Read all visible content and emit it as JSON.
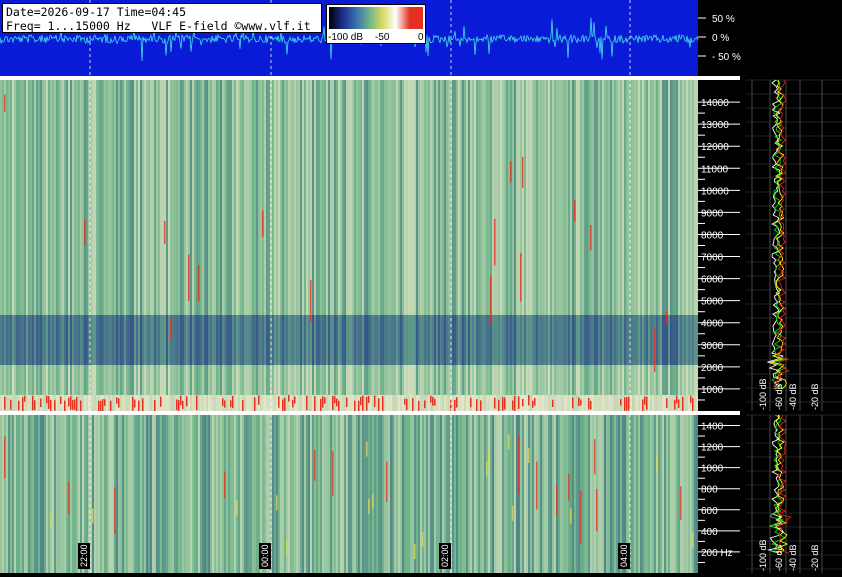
{
  "header": {
    "line1": "Date=2026-09-17 Time=04:45",
    "line2": "Freq= 1...15000 Hz   VLF E-field ©www.vlf.it"
  },
  "colorbar": {
    "labels": [
      "-100 dB",
      "-50",
      "0"
    ],
    "colors": [
      "#000000",
      "#1b2a8a",
      "#3a6fb0",
      "#6fb48a",
      "#d8d860",
      "#ffffff",
      "#e03020",
      "#e83020"
    ]
  },
  "waveform": {
    "background": "#0a1bd8",
    "trace_color": "#40e0e8",
    "ticks": [
      "50 %",
      "0 %",
      "- 50 %"
    ]
  },
  "chart_data": [
    {
      "type": "heatmap",
      "title": "",
      "xlabel": "",
      "ylabel": "",
      "x_ticks": [
        "22:00",
        "00:00",
        "02:00",
        "04:00"
      ],
      "upper": {
        "y_ticks": [
          1000,
          2000,
          3000,
          4000,
          5000,
          6000,
          7000,
          8000,
          9000,
          10000,
          11000,
          12000,
          13000,
          14000
        ],
        "ylim": [
          0,
          15000
        ]
      },
      "lower": {
        "y_ticks": [
          "200 Hz",
          "400",
          "600",
          "800",
          "1000",
          "1200",
          "1400"
        ],
        "ylim": [
          0,
          1500
        ]
      },
      "colors": {
        "low": "#1b2a8a",
        "mid": "#6fb48a",
        "high": "#e83020"
      }
    },
    {
      "type": "line",
      "title": "",
      "xlabel": "",
      "ylabel": "",
      "x_ticks": [
        "-100 dB",
        "-60 dB",
        "-40 dB",
        "-20 dB"
      ],
      "series_colors": [
        "#ffffff",
        "#00e000",
        "#ffff00",
        "#e02020"
      ]
    }
  ]
}
